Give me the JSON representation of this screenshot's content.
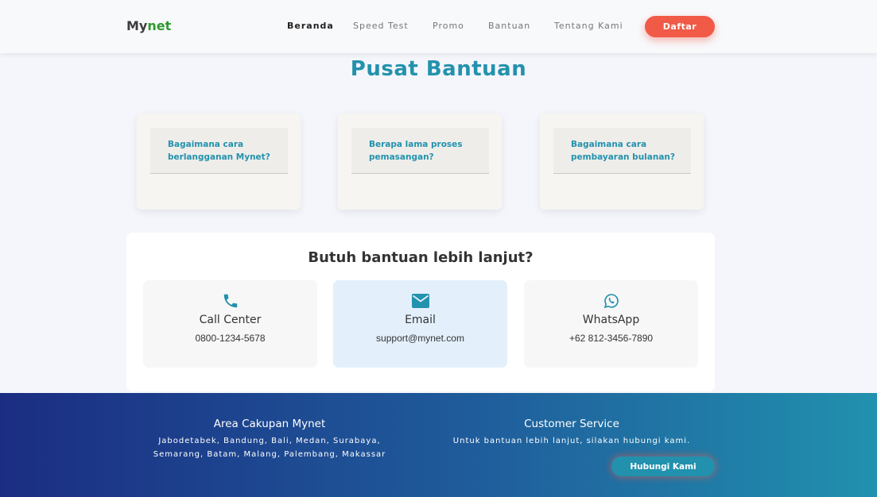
{
  "brand": {
    "part1": "My",
    "part2": "net"
  },
  "nav": {
    "items": [
      {
        "label": "Beranda",
        "active": true
      },
      {
        "label": "Speed Test",
        "active": false
      },
      {
        "label": "Promo",
        "active": false
      },
      {
        "label": "Bantuan",
        "active": false
      },
      {
        "label": "Tentang Kami",
        "active": false
      }
    ],
    "cta": "Daftar"
  },
  "page": {
    "title": "Pusat Bantuan"
  },
  "faq": [
    {
      "question": "Bagaimana cara berlangganan Mynet?"
    },
    {
      "question": "Berapa lama proses pemasangan?"
    },
    {
      "question": "Bagaimana cara pembayaran bulanan?"
    }
  ],
  "help": {
    "title": "Butuh bantuan lebih lanjut?",
    "contacts": [
      {
        "icon": "phone-icon",
        "label": "Call Center",
        "value": "0800-1234-5678"
      },
      {
        "icon": "envelope-icon",
        "label": "Email",
        "value": "support@mynet.com"
      },
      {
        "icon": "whatsapp-icon",
        "label": "WhatsApp",
        "value": "+62 812-3456-7890"
      }
    ]
  },
  "footer": {
    "coverage": {
      "title": "Area Cakupan Mynet",
      "line1": "Jabodetabek, Bandung, Bali, Medan, Surabaya,",
      "line2": "Semarang, Batam, Malang, Palembang, Makassar"
    },
    "service": {
      "title": "Customer Service",
      "text": "Untuk bantuan lebih lanjut, silakan hubungi kami.",
      "button": "Hubungi Kami"
    }
  },
  "colors": {
    "accent": "#2392ad",
    "cta": "#f05a47",
    "brand_green": "#2e9a2e",
    "footer_start": "#1b2d82",
    "footer_end": "#2191ae"
  }
}
